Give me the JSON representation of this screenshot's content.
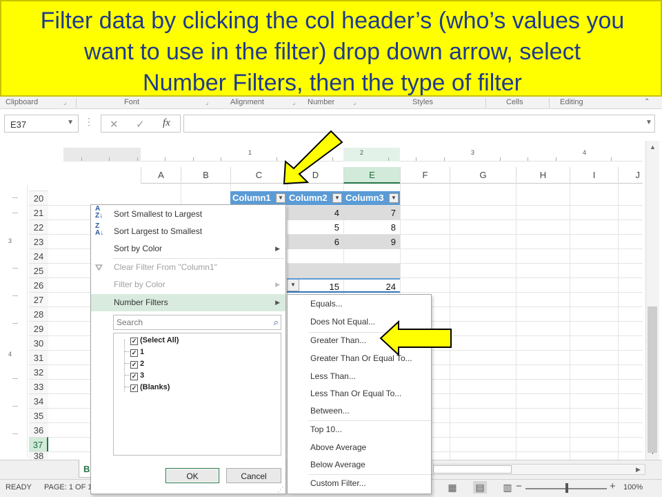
{
  "banner": {
    "line1": "Filter data by clicking the col header’s (who’s values you",
    "line2": "want to use in the filter) drop down arrow, select",
    "line3": "Number Filters, then the type of filter",
    "background": "#ffff00",
    "text_color": "#1f3b8c"
  },
  "ribbon_groups": [
    "Clipboard",
    "Font",
    "Alignment",
    "Number",
    "Styles",
    "Cells",
    "Editing"
  ],
  "formula_bar": {
    "name_box": "E37",
    "fx_label": "fx",
    "formula": ""
  },
  "ruler": [
    "1",
    "2",
    "3",
    "4"
  ],
  "left_ruler": [
    "3",
    "4"
  ],
  "columns": [
    "A",
    "B",
    "C",
    "D",
    "E",
    "F",
    "G",
    "H",
    "I",
    "J"
  ],
  "selected_column": "E",
  "rows": [
    "20",
    "21",
    "22",
    "23",
    "24",
    "25",
    "26",
    "27",
    "28",
    "29",
    "30",
    "31",
    "32",
    "33",
    "34",
    "35",
    "36",
    "37",
    "38"
  ],
  "selected_row": "37",
  "table": {
    "headers": [
      "Column1",
      "Column2",
      "Column3"
    ],
    "body": [
      [
        "4",
        "7"
      ],
      [
        "5",
        "8"
      ],
      [
        "6",
        "9"
      ]
    ],
    "totals": [
      "15",
      "24"
    ]
  },
  "filter_menu": {
    "items": [
      {
        "label": "Sort Smallest to Largest",
        "icon": "sort-ascending-icon"
      },
      {
        "label": "Sort Largest to Smallest",
        "icon": "sort-descending-icon"
      },
      {
        "label": "Sort by Color"
      },
      {
        "label": "Clear Filter From \"Column1\"",
        "icon": "clear-filter-icon",
        "disabled": true
      },
      {
        "label": "Filter by Color",
        "disabled": true
      },
      {
        "label": "Number Filters",
        "highlighted": true
      }
    ],
    "search_placeholder": "Search",
    "checklist": [
      "(Select All)",
      "1",
      "2",
      "3",
      "(Blanks)"
    ],
    "ok_label": "OK",
    "cancel_label": "Cancel"
  },
  "number_filters_menu": [
    "Equals...",
    "Does Not Equal...",
    "Greater Than...",
    "Greater Than Or Equal To...",
    "Less Than...",
    "Less Than Or Equal To...",
    "Between...",
    "Top 10...",
    "Above Average",
    "Below Average",
    "Custom Filter..."
  ],
  "sheet_tab": "Bu",
  "status_bar": {
    "ready": "READY",
    "page": "PAGE: 1 OF 1",
    "zoom": "100%"
  },
  "colors": {
    "table_header": "#5b9bd5",
    "band": "#dcdcdc",
    "highlight": "#d9ebdf",
    "arrow_fill": "#ffff00",
    "excel_green": "#217346"
  }
}
